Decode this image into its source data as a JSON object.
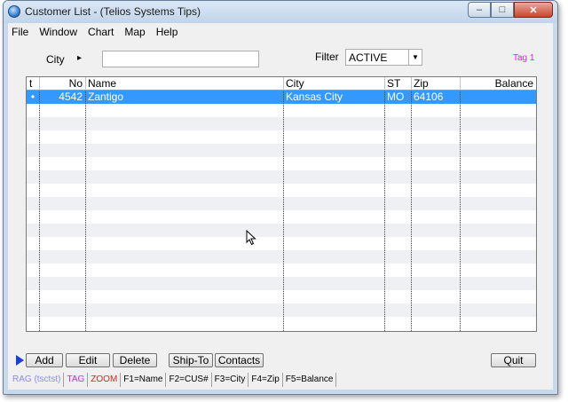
{
  "window": {
    "title": "Customer List - (Telios Systems Tips)"
  },
  "menu": [
    "File",
    "Window",
    "Chart",
    "Map",
    "Help"
  ],
  "filters": {
    "city_label": "City",
    "city_arrow": "▸",
    "city_value": "",
    "filter_label": "Filter",
    "filter_value": "ACTIVE",
    "tag_label": "Tag 1"
  },
  "grid": {
    "columns": [
      "t",
      "No",
      "Name",
      "City",
      "ST",
      "Zip",
      "Balance"
    ],
    "rows": [
      {
        "t": "•",
        "no": "4542",
        "name": "Zantigo",
        "city": "Kansas City",
        "st": "MO",
        "zip": "64106",
        "balance": ""
      }
    ]
  },
  "buttons": {
    "add": "Add",
    "edit": "Edit",
    "delete": "Delete",
    "ship_to": "Ship-To",
    "contacts": "Contacts",
    "quit": "Quit"
  },
  "status": [
    {
      "text": "RAG (tsctst)",
      "color": "#8a8af0"
    },
    {
      "text": "TAG",
      "color": "#e020e0"
    },
    {
      "text": "ZOOM",
      "color": "#e02020"
    },
    {
      "text": "F1=Name",
      "color": "#000000"
    },
    {
      "text": "F2=CUS#",
      "color": "#000000"
    },
    {
      "text": "F3=City",
      "color": "#000000"
    },
    {
      "text": "F4=Zip",
      "color": "#000000"
    },
    {
      "text": "F5=Balance",
      "color": "#000000"
    }
  ],
  "colors": {
    "selection": "#3399ff",
    "tag": "#e020e0"
  }
}
